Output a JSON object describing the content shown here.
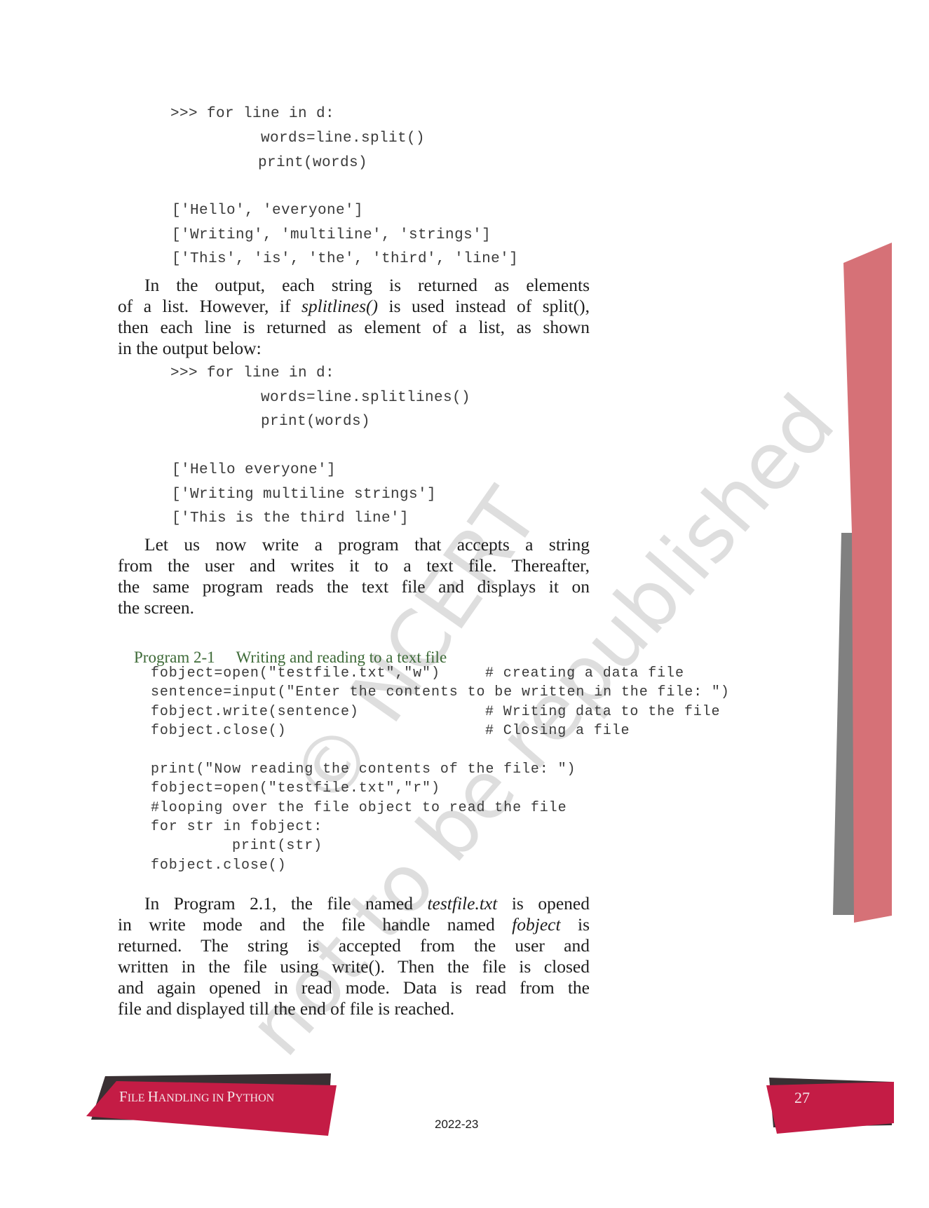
{
  "code_block_1": {
    "lines": [
      ">>> for line in d:",
      "words=line.split()",
      "print(words)"
    ],
    "output": [
      "['Hello', 'everyone']",
      "['Writing', 'multiline', 'strings']",
      "['This', 'is', 'the', 'third', 'line']"
    ]
  },
  "paragraph_1": {
    "lines": [
      "In the output, each string is returned as elements",
      [
        "of a list. However, if ",
        "splitlines()",
        " is used instead of split(),"
      ],
      "then each line is returned as element of a list, as shown",
      "in the output below:"
    ]
  },
  "code_block_2": {
    "lines": [
      ">>> for line in d:",
      "words=line.splitlines()",
      "print(words)"
    ],
    "output": [
      "['Hello everyone']",
      "['Writing multiline strings']",
      "['This is the third line']"
    ]
  },
  "paragraph_2": {
    "lines": [
      "Let us now write a program that accepts a string",
      "from the user and writes it to a text file. Thereafter,",
      "the same program reads the text file and displays it on",
      "the screen."
    ]
  },
  "program": {
    "label": "Program 2-1",
    "title": "Writing and reading to a text file",
    "code": [
      {
        "code": "fobject=open(\"testfile.txt\",\"w\")",
        "comment": "# creating a data file"
      },
      {
        "code": "sentence=input(\"Enter the contents to be written in the file: \")",
        "comment": ""
      },
      {
        "code": "fobject.write(sentence)",
        "comment": "# Writing data to the file"
      },
      {
        "code": "fobject.close()",
        "comment": "# Closing a file"
      }
    ],
    "code_2": [
      "print(\"Now reading the contents of the file: \")",
      "fobject=open(\"testfile.txt\",\"r\")",
      "#looping over the file object to read the file",
      "for str in fobject:",
      "print(str)",
      "fobject.close()"
    ]
  },
  "paragraph_3": {
    "lines": [
      [
        "In Program 2.1, the file named ",
        "testfile.txt",
        " is opened"
      ],
      [
        "in write mode and the file handle named ",
        "fobject",
        " is"
      ],
      "returned. The string is accepted from the user and",
      "written in the file using write(). Then the file is closed",
      "and again opened in read mode. Data is read from the",
      "file and displayed till the end of file is reached."
    ]
  },
  "watermark": {
    "line_1": "© NCERT",
    "line_2": "not to be republished"
  },
  "footer": {
    "chapter_title": "File Handling in Python",
    "page_number": "27",
    "year": "2022-23"
  },
  "colors": {
    "banner_red": "#c41c45",
    "banner_shadow": "#3a3033",
    "side_bar_red": "#d67177",
    "side_bar_gray": "#808080",
    "heading_green": "#3d6a37"
  }
}
